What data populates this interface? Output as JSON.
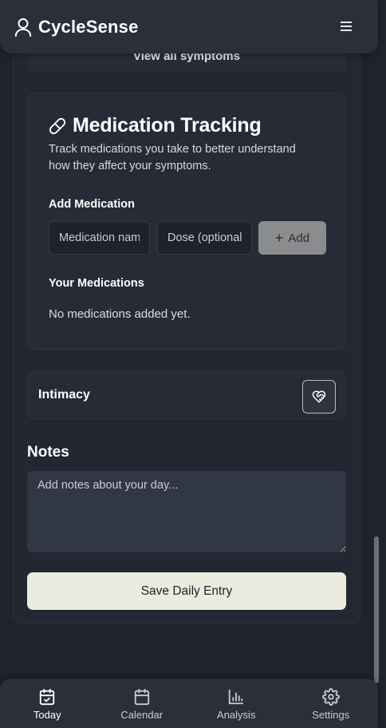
{
  "app": {
    "title": "CycleSense",
    "menu_icon": "hamburger-menu-icon"
  },
  "symptoms": {
    "view_all_label": "View all symptoms"
  },
  "medication": {
    "title": "Medication Tracking",
    "description": "Track medications you take to better understand how they affect your symptoms.",
    "add_label": "Add Medication",
    "name_placeholder": "Medication name",
    "dose_placeholder": "Dose (optional)",
    "add_button": "Add",
    "list_label": "Your Medications",
    "empty_text": "No medications added yet."
  },
  "intimacy": {
    "label": "Intimacy",
    "icon": "heart-handshake-icon"
  },
  "notes": {
    "title": "Notes",
    "placeholder": "Add notes about your day..."
  },
  "save": {
    "label": "Save Daily Entry"
  },
  "nav": {
    "items": [
      {
        "label": "Today",
        "icon": "calendar-check-icon",
        "active": true
      },
      {
        "label": "Calendar",
        "icon": "calendar-icon",
        "active": false
      },
      {
        "label": "Analysis",
        "icon": "bar-chart-icon",
        "active": false
      },
      {
        "label": "Settings",
        "icon": "gear-icon",
        "active": false
      }
    ]
  },
  "colors": {
    "background": "#1f232d",
    "card": "#262b36",
    "accent": "#ebebdf",
    "add_button": "#8a8c8d"
  }
}
